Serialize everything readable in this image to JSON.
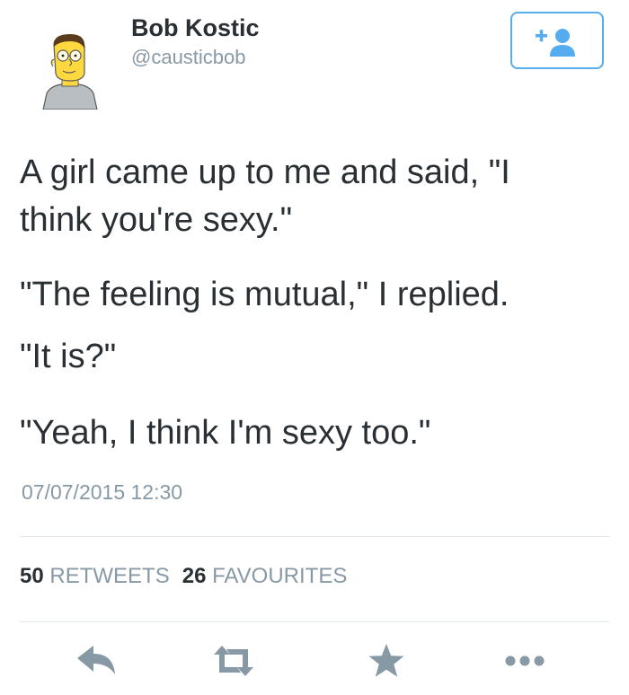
{
  "user": {
    "name": "Bob Kostic",
    "handle": "@causticbob"
  },
  "tweet": {
    "paragraphs": [
      [
        "A girl came up to me and said, \"I",
        "think you're sexy.\""
      ],
      [
        "\"The feeling is mutual,\" I replied."
      ],
      [
        "\"It is?\""
      ],
      [
        "\"Yeah, I think I'm sexy too.\""
      ]
    ],
    "timestamp": "07/07/2015 12:30"
  },
  "stats": {
    "retweets_count": "50",
    "retweets_label": "RETWEETS",
    "favourites_count": "26",
    "favourites_label": "FAVOURITES"
  },
  "actions": {
    "icons": [
      "reply-icon",
      "retweet-icon",
      "star-icon",
      "more-icon"
    ]
  },
  "colors": {
    "text": "#292f33",
    "muted": "#8899a6",
    "accent": "#55acee",
    "divider": "#e1e8ed",
    "avatar_skin": "#fdd83f"
  }
}
